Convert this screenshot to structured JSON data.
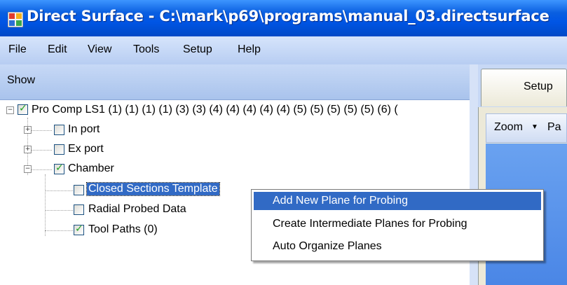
{
  "window": {
    "title": "Direct Surface - C:\\mark\\p69\\programs\\manual_03.directsurface",
    "icon": "app-icon"
  },
  "menubar": {
    "items": [
      "File",
      "Edit",
      "View",
      "Tools",
      "Setup",
      "Help"
    ]
  },
  "toolbar": {
    "show_label": "Show"
  },
  "tree": {
    "root": {
      "label": "Pro Comp LS1 (1) (1) (1) (1) (3) (3) (4) (4) (4) (4) (4) (5) (5) (5) (5) (5) (6) (",
      "checked": true,
      "expanded": true
    },
    "children": [
      {
        "label": "In port",
        "checked": false,
        "expanded": false
      },
      {
        "label": "Ex port",
        "checked": false,
        "expanded": false
      },
      {
        "label": "Chamber",
        "checked": true,
        "expanded": true
      }
    ],
    "chamber_children": [
      {
        "label": "Closed Sections Template",
        "checked": false,
        "selected": true
      },
      {
        "label": "Radial Probed Data",
        "checked": false,
        "selected": false
      },
      {
        "label": "Tool Paths (0)",
        "checked": true,
        "selected": false
      }
    ]
  },
  "right_panel": {
    "tab_label": "Setup",
    "zoom_label": "Zoom",
    "pan_label": "Pa"
  },
  "context_menu": {
    "items": [
      {
        "label": "Add New Plane for Probing",
        "highlighted": true
      },
      {
        "label": "Create Intermediate Planes for Probing",
        "highlighted": false
      },
      {
        "label": "Auto Organize Planes",
        "highlighted": false
      }
    ]
  },
  "colors": {
    "title_bar": "#0055e5",
    "selection": "#316ac5",
    "check_mark": "#21a121",
    "viewport": "#5a93ec"
  }
}
